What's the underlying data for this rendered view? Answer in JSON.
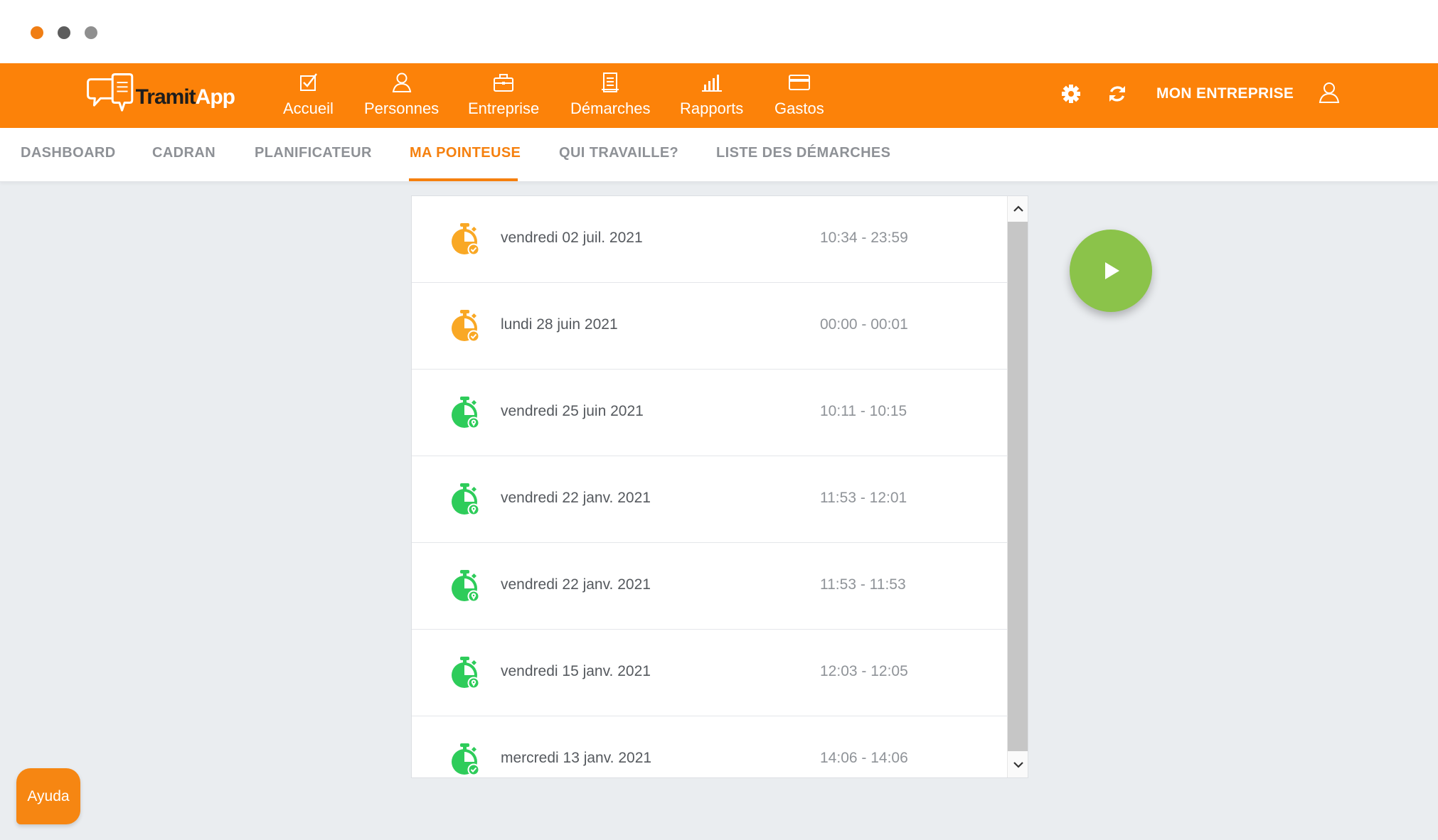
{
  "window": {
    "controls": [
      "close",
      "minimize",
      "maximize"
    ]
  },
  "brand": {
    "name_part1": "Tramit",
    "name_part2": "App",
    "logo_icon": "speech-bubbles-icon"
  },
  "header": {
    "nav": [
      {
        "label": "Accueil",
        "icon": "checkbox-icon"
      },
      {
        "label": "Personnes",
        "icon": "person-icon"
      },
      {
        "label": "Entreprise",
        "icon": "briefcase-icon"
      },
      {
        "label": "Démarches",
        "icon": "document-icon"
      },
      {
        "label": "Rapports",
        "icon": "bar-chart-icon"
      },
      {
        "label": "Gastos",
        "icon": "credit-card-icon"
      }
    ],
    "settings_icon": "gear-icon",
    "refresh_icon": "refresh-icon",
    "company_label": "MON ENTREPRISE",
    "user_icon": "user-icon"
  },
  "tabs": [
    {
      "label": "DASHBOARD",
      "active": false
    },
    {
      "label": "CADRAN",
      "active": false
    },
    {
      "label": "PLANIFICATEUR",
      "active": false
    },
    {
      "label": "MA POINTEUSE",
      "active": true
    },
    {
      "label": "QUI TRAVAILLE?",
      "active": false
    },
    {
      "label": "LISTE DES DÉMARCHES",
      "active": false
    }
  ],
  "entries": [
    {
      "date": "vendredi 02 juil. 2021",
      "time": "10:34 - 23:59",
      "status": "pending",
      "icon": "stopwatch-check-icon"
    },
    {
      "date": "lundi 28 juin 2021",
      "time": "00:00 - 00:01",
      "status": "pending",
      "icon": "stopwatch-check-icon"
    },
    {
      "date": "vendredi 25 juin 2021",
      "time": "10:11 - 10:15",
      "status": "located",
      "icon": "stopwatch-pin-icon"
    },
    {
      "date": "vendredi 22 janv. 2021",
      "time": "11:53 - 12:01",
      "status": "located",
      "icon": "stopwatch-pin-icon"
    },
    {
      "date": "vendredi 22 janv. 2021",
      "time": "11:53 - 11:53",
      "status": "located",
      "icon": "stopwatch-pin-icon"
    },
    {
      "date": "vendredi 15 janv. 2021",
      "time": "12:03 - 12:05",
      "status": "located",
      "icon": "stopwatch-pin-icon"
    },
    {
      "date": "mercredi 13 janv. 2021",
      "time": "14:06 - 14:06",
      "status": "approved",
      "icon": "stopwatch-check-icon"
    }
  ],
  "status_colors": {
    "pending": "#f9a825",
    "located": "#2ecc5a",
    "approved": "#2ecc5a"
  },
  "play_button": {
    "icon": "play-icon",
    "color": "#8bc34a"
  },
  "help": {
    "label": "Ayuda"
  },
  "colors": {
    "brand": "#fc8209",
    "active_tab": "#f5800e",
    "background": "#eaedf0"
  }
}
